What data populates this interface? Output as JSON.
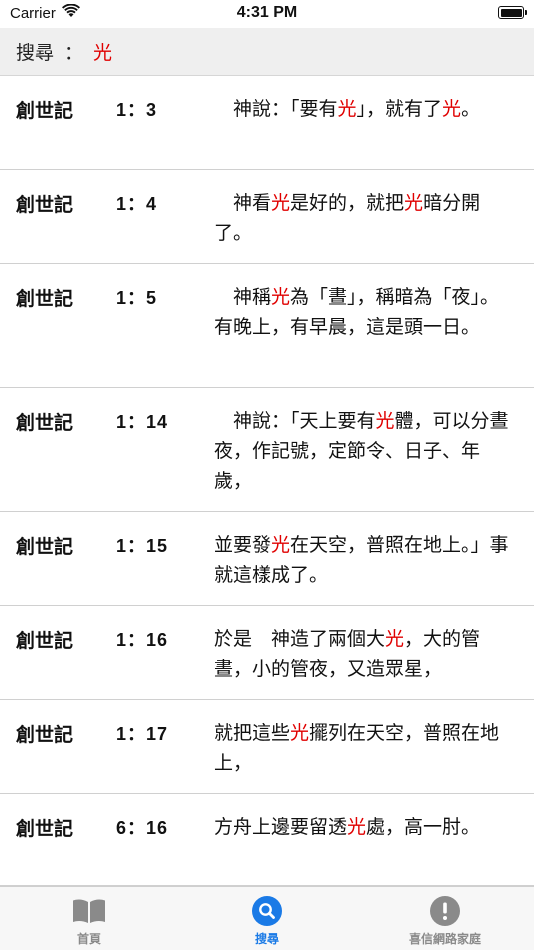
{
  "status_bar": {
    "carrier": "Carrier",
    "time": "4:31 PM",
    "battery_level": 1.0
  },
  "search": {
    "label": "搜尋",
    "separator": "：",
    "term": "光"
  },
  "results": [
    {
      "book": "創世記",
      "ref": "1：3",
      "segments": [
        "　神說：「要有",
        "光",
        "」，就有了",
        "光",
        "。"
      ],
      "height": 94
    },
    {
      "book": "創世記",
      "ref": "1：4",
      "segments": [
        "　神看",
        "光",
        "是好的，就把",
        "光",
        "暗分開了。"
      ],
      "height": 94
    },
    {
      "book": "創世記",
      "ref": "1：5",
      "segments": [
        "　神稱",
        "光",
        "為「晝」，稱暗為「夜」。有晚上，有早晨，這是頭一日。"
      ],
      "height": 124
    },
    {
      "book": "創世記",
      "ref": "1：14",
      "segments": [
        "　神說：「天上要有",
        "光",
        "體，可以分晝夜，作記號，定節令、日子、年歲，"
      ],
      "height": 124
    },
    {
      "book": "創世記",
      "ref": "1：15",
      "segments": [
        "並要發",
        "光",
        "在天空，普照在地上。」事就這樣成了。"
      ],
      "height": 94
    },
    {
      "book": "創世記",
      "ref": "1：16",
      "segments": [
        "於是　神造了兩個大",
        "光",
        "，大的管晝，小的管夜，又造眾星，"
      ],
      "height": 94
    },
    {
      "book": "創世記",
      "ref": "1：17",
      "segments": [
        "就把這些",
        "光",
        "擺列在天空，普照在地上，"
      ],
      "height": 94
    },
    {
      "book": "創世記",
      "ref": "6：16",
      "segments": [
        "方舟上邊要留透",
        "光",
        "處，高一肘。"
      ],
      "height": 92
    }
  ],
  "tabs": [
    {
      "label": "首頁",
      "icon": "book-icon",
      "active": false
    },
    {
      "label": "搜尋",
      "icon": "search-icon",
      "active": true
    },
    {
      "label": "喜信網路家庭",
      "icon": "info-icon",
      "active": false
    }
  ],
  "colors": {
    "highlight": "#e00000",
    "tab_active": "#1a7ae6",
    "tab_inactive": "#8a8a8a",
    "header_bg": "#efefef"
  }
}
